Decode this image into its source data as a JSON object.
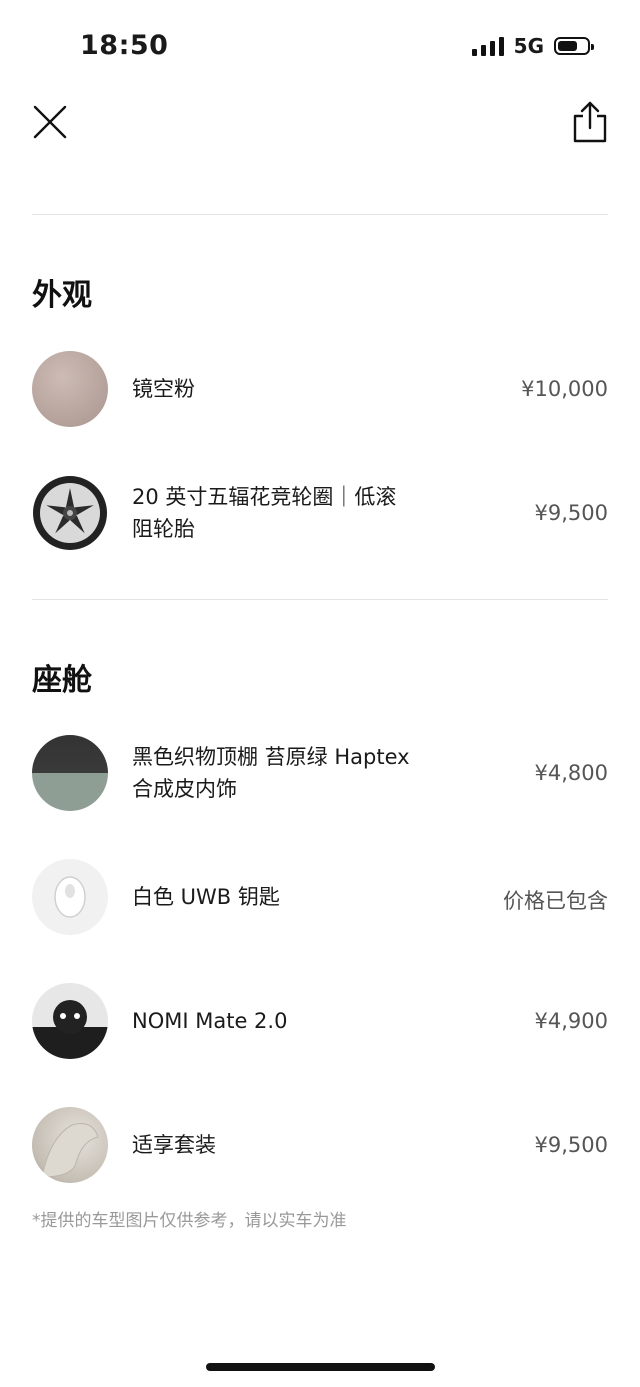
{
  "status_bar": {
    "time": "18:50",
    "network": "5G"
  },
  "nav": {
    "close_icon": "close-icon",
    "share_icon": "share-icon"
  },
  "sections": [
    {
      "title": "外观",
      "items": [
        {
          "label": "镜空粉",
          "price": "¥10,000",
          "thumb": "swatch-pink",
          "color": "#b8a39c"
        },
        {
          "label_line1": "20 英寸五辐花竞轮圈｜低滚",
          "label_line2": "阻轮胎",
          "price": "¥9,500",
          "thumb": "wheel-image"
        }
      ]
    },
    {
      "title": "座舱",
      "items": [
        {
          "label_line1": "黑色织物顶棚 苔原绿 Haptex",
          "label_line2": "合成皮内饰",
          "price": "¥4,800",
          "thumb": "interior-swatch",
          "colors": [
            "#333333",
            "#8e9e94"
          ]
        },
        {
          "label": "白色 UWB 钥匙",
          "price": "价格已包含",
          "thumb": "key-image"
        },
        {
          "label": "NOMI Mate 2.0",
          "price": "¥4,900",
          "thumb": "nomi-image"
        },
        {
          "label": "适享套装",
          "price": "¥9,500",
          "thumb": "seat-image"
        }
      ]
    }
  ],
  "disclaimer": "*提供的车型图片仅供参考，请以实车为准"
}
